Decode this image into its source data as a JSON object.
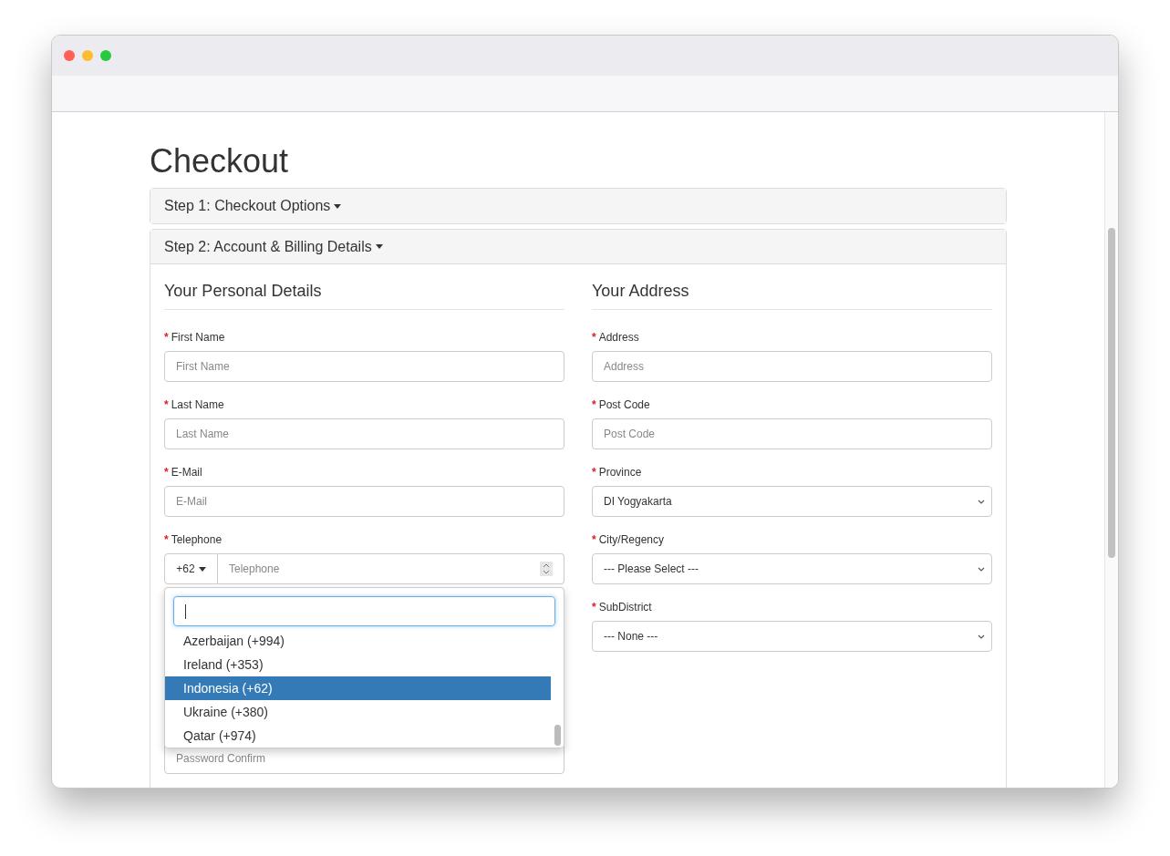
{
  "page_title": "Checkout",
  "required_mark": "*",
  "steps": [
    {
      "label": "Step 1: Checkout Options",
      "expanded": false
    },
    {
      "label": "Step 2: Account & Billing Details",
      "expanded": true
    }
  ],
  "personal_details": {
    "heading": "Your Personal Details",
    "fields": [
      {
        "kind": "text",
        "label": "First Name",
        "required": true,
        "placeholder": "First Name"
      },
      {
        "kind": "text",
        "label": "Last Name",
        "required": true,
        "placeholder": "Last Name"
      },
      {
        "kind": "text",
        "label": "E-Mail",
        "required": true,
        "placeholder": "E-Mail"
      },
      {
        "kind": "phone",
        "label": "Telephone",
        "required": true,
        "code": "+62",
        "placeholder": "Telephone"
      }
    ]
  },
  "country_dropdown": {
    "options": [
      {
        "label": "Azerbaijan (+994)",
        "selected": false
      },
      {
        "label": "Ireland (+353)",
        "selected": false
      },
      {
        "label": "Indonesia (+62)",
        "selected": true
      },
      {
        "label": "Ukraine (+380)",
        "selected": false
      },
      {
        "label": "Qatar (+974)",
        "selected": false
      }
    ]
  },
  "covered_field": {
    "placeholder": "Password Confirm"
  },
  "address": {
    "heading": "Your Address",
    "fields": [
      {
        "kind": "text",
        "label": "Address",
        "required": true,
        "placeholder": "Address"
      },
      {
        "kind": "text",
        "label": "Post Code",
        "required": true,
        "placeholder": "Post Code"
      },
      {
        "kind": "select",
        "label": "Province",
        "required": true,
        "value": "DI Yogyakarta"
      },
      {
        "kind": "select",
        "label": "City/Regency",
        "required": true,
        "value": "--- Please Select ---"
      },
      {
        "kind": "select",
        "label": "SubDistrict",
        "required": true,
        "value": "--- None ---"
      }
    ]
  }
}
